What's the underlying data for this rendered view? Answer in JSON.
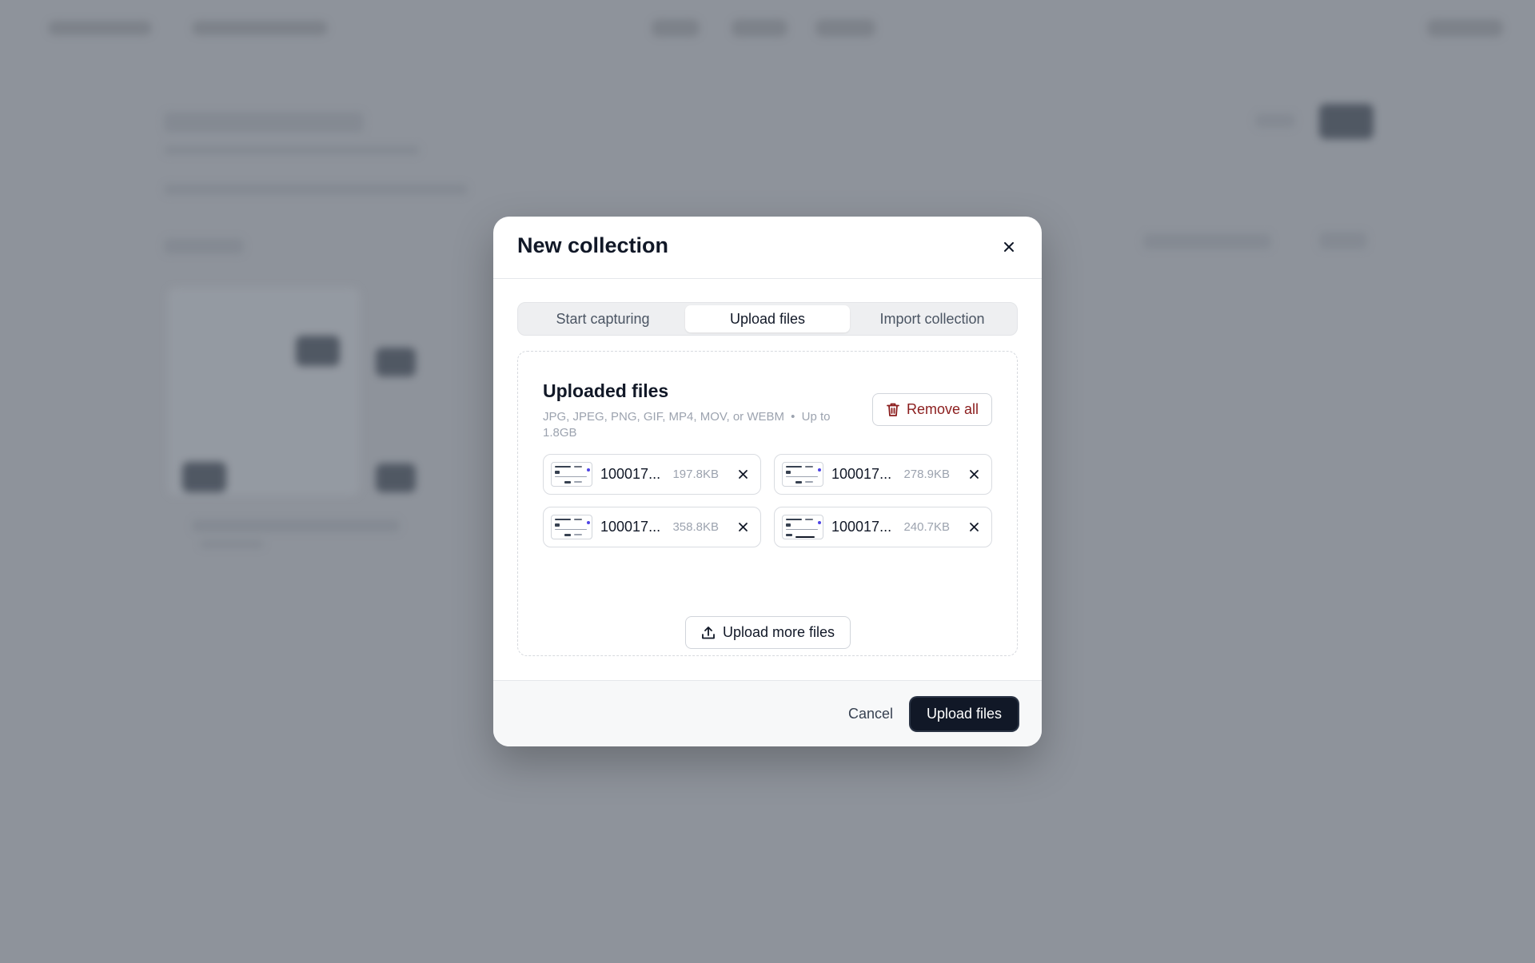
{
  "modal": {
    "title": "New collection",
    "tabs": [
      {
        "label": "Start capturing",
        "active": false
      },
      {
        "label": "Upload files",
        "active": true
      },
      {
        "label": "Import collection",
        "active": false
      }
    ],
    "dropzone": {
      "title": "Uploaded files",
      "formats": "JPG, JPEG, PNG, GIF, MP4, MOV, or WEBM",
      "separator": "•",
      "limit": "Up to 1.8GB",
      "remove_all_label": "Remove all",
      "files": [
        {
          "name": "100017...",
          "size": "197.8KB"
        },
        {
          "name": "100017...",
          "size": "278.9KB"
        },
        {
          "name": "100017...",
          "size": "358.8KB"
        },
        {
          "name": "100017...",
          "size": "240.7KB"
        }
      ],
      "upload_more_label": "Upload more files"
    },
    "footer": {
      "cancel_label": "Cancel",
      "primary_label": "Upload files"
    }
  },
  "icons": {
    "close": "close-icon",
    "trash": "trash-icon",
    "upload": "upload-icon",
    "remove_file": "close-icon"
  },
  "colors": {
    "overlay": "#8e939b",
    "primary": "#111827",
    "danger_text": "#8b1d1d"
  }
}
